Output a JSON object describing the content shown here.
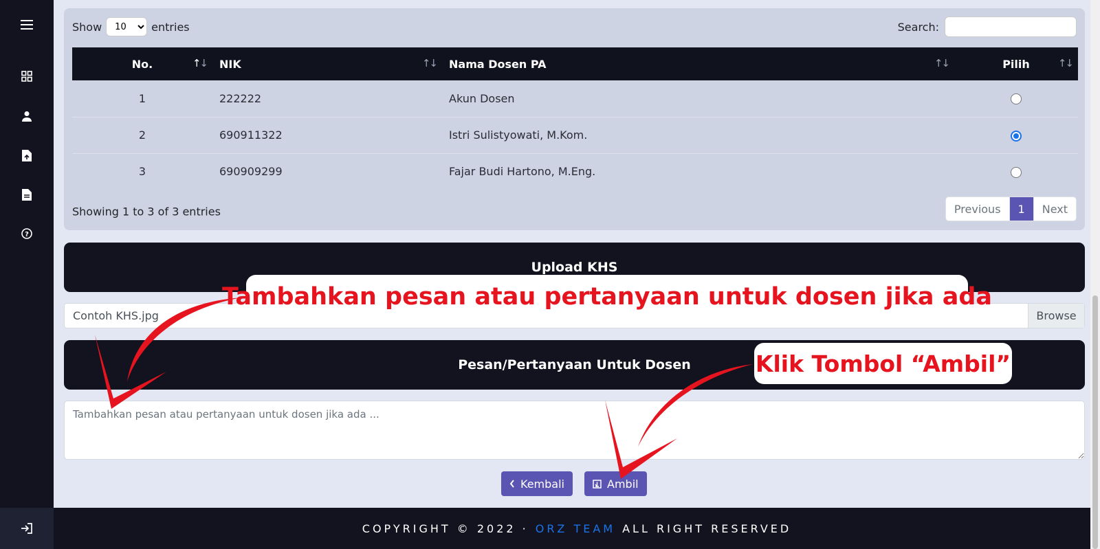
{
  "table_controls": {
    "show_label": "Show",
    "entries_value": "10",
    "entries_label": "entries",
    "search_label": "Search:",
    "search_value": ""
  },
  "table": {
    "headers": [
      "No.",
      "NIK",
      "Nama Dosen PA",
      "Pilih"
    ],
    "rows": [
      {
        "no": "1",
        "nik": "222222",
        "nama": "Akun Dosen",
        "selected": false
      },
      {
        "no": "2",
        "nik": "690911322",
        "nama": "Istri Sulistyowati, M.Kom.",
        "selected": true
      },
      {
        "no": "3",
        "nik": "690909299",
        "nama": "Fajar Budi Hartono, M.Eng.",
        "selected": false
      }
    ],
    "info": "Showing 1 to 3 of 3 entries",
    "pagination": {
      "previous": "Previous",
      "page": "1",
      "next": "Next"
    }
  },
  "upload": {
    "title": "Upload KHS",
    "file_name": "Contoh KHS.jpg",
    "browse_label": "Browse"
  },
  "message": {
    "title": "Pesan/Pertanyaan Untuk Dosen",
    "placeholder": "Tambahkan pesan atau pertanyaan untuk dosen jika ada ..."
  },
  "buttons": {
    "back_label": "Kembali",
    "take_label": "Ambil"
  },
  "footer": {
    "prefix": "COPYRIGHT © 2022 ·",
    "team": "ORZ TEAM",
    "suffix": "ALL RIGHT RESERVED"
  },
  "annotations": {
    "message_hint": "Tambahkan pesan atau pertanyaan untuk dosen jika ada",
    "button_hint": "Klik Tombol “Ambil”"
  },
  "colors": {
    "primary": "#5a55b3",
    "dark": "#12131f",
    "annotation": "#e5141e",
    "link": "#1a73e8"
  }
}
